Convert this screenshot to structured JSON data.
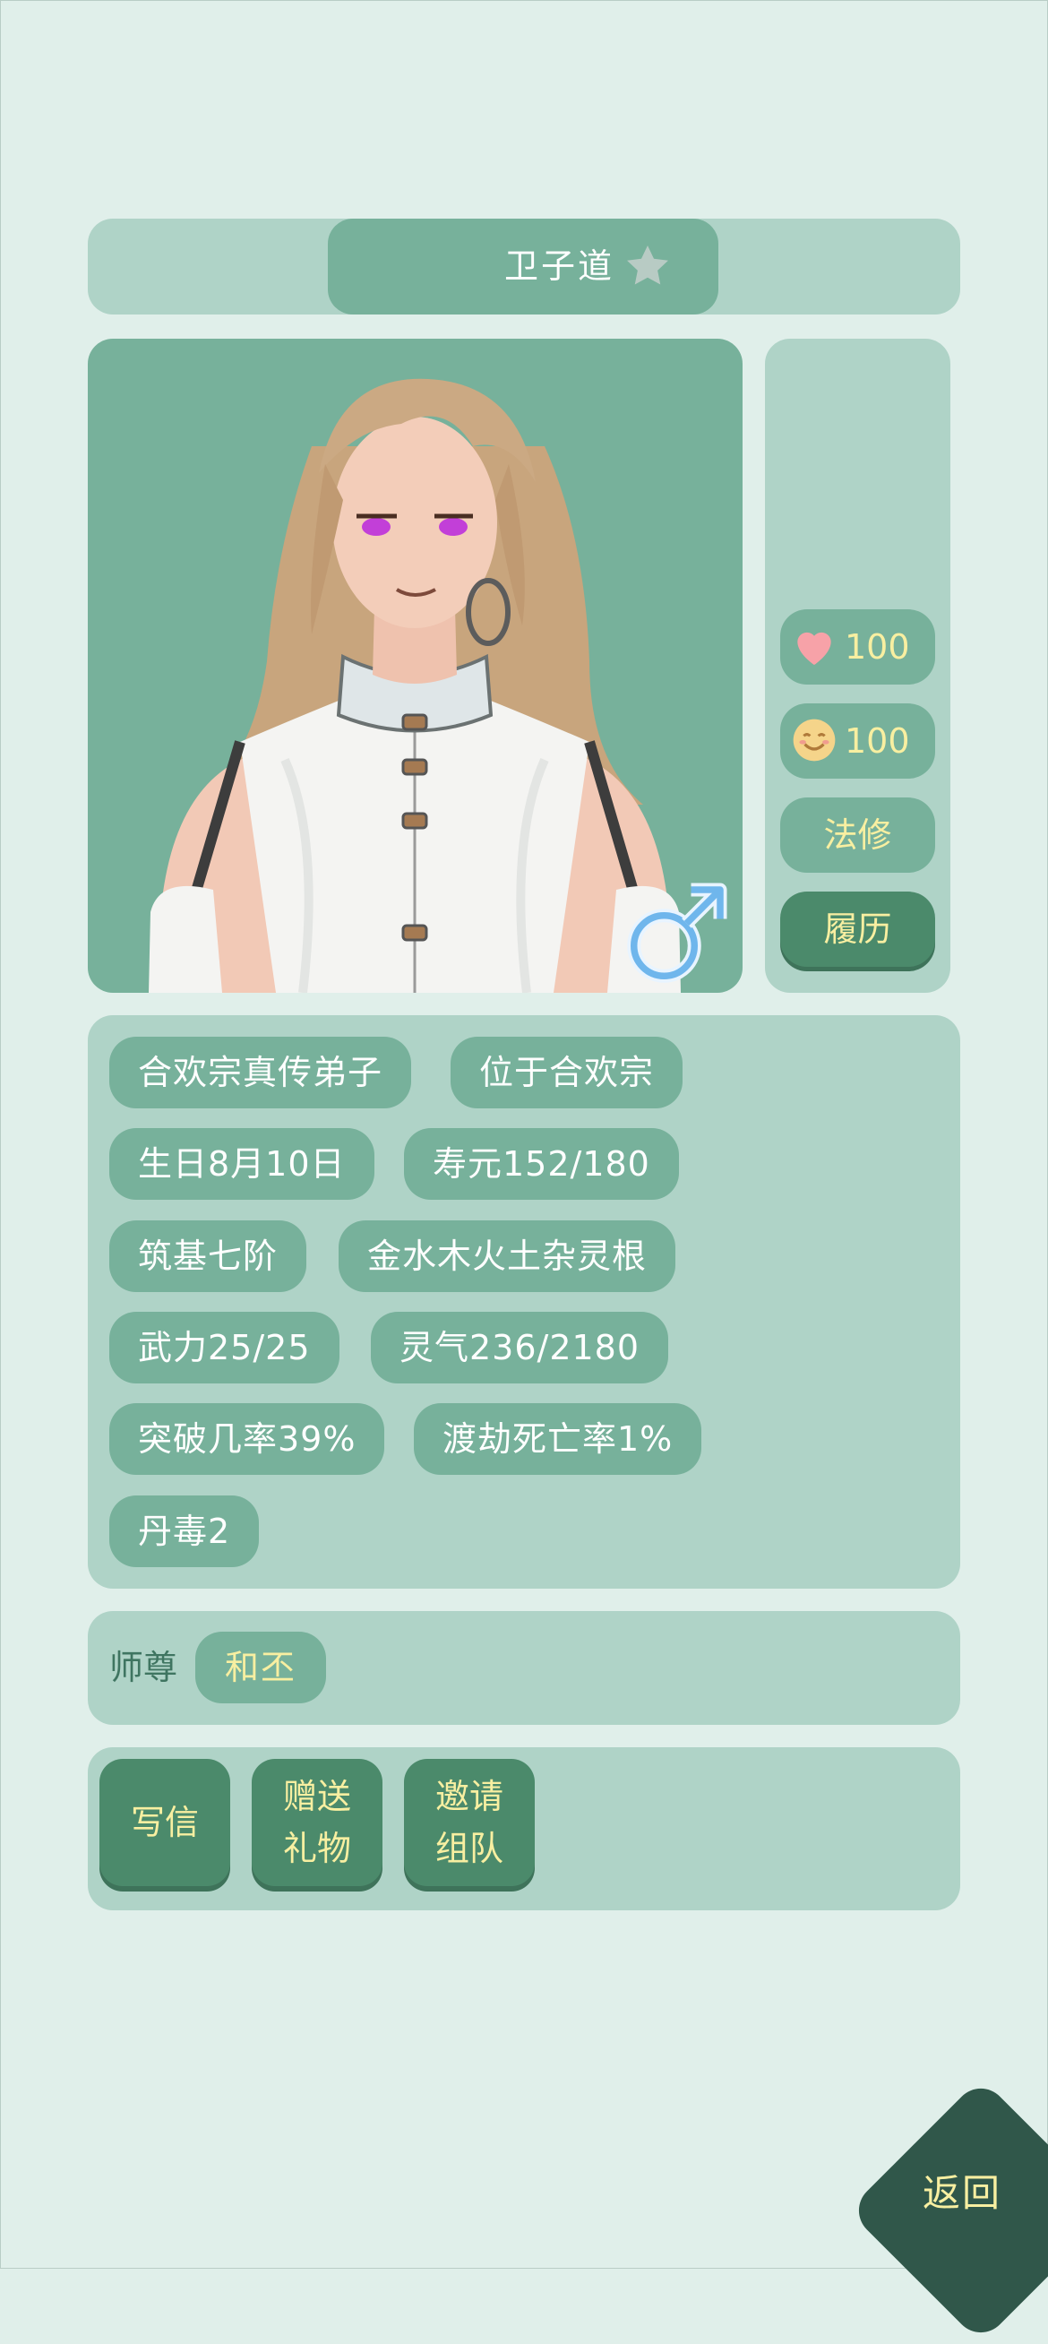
{
  "header": {
    "name": "卫子道",
    "favorite_icon": "star-icon"
  },
  "portrait": {
    "gender_icon": "male-symbol-icon"
  },
  "side_panel": {
    "affection": {
      "icon": "heart-icon",
      "value": "100"
    },
    "mood": {
      "icon": "smile-face-icon",
      "value": "100"
    },
    "cultivation_type": "法修",
    "history_button": "履历"
  },
  "info_tags": {
    "sect_rank": "合欢宗真传弟子",
    "location": "位于合欢宗",
    "birthday": "生日8月10日",
    "lifespan": "寿元152/180",
    "realm": "筑基七阶",
    "spirit_root": "金水木火土杂灵根",
    "martial": "武力25/25",
    "qi": "灵气236/2180",
    "breakthrough": "突破几率39%",
    "tribulation": "渡劫死亡率1%",
    "pill_toxicity": "丹毒2"
  },
  "master": {
    "label": "师尊",
    "name": "和丕"
  },
  "actions": {
    "write_letter": "写信",
    "gift_line1": "赠送",
    "gift_line2": "礼物",
    "invite_line1": "邀请",
    "invite_line2": "组队"
  },
  "back_button": "返回",
  "colors": {
    "background": "#e0efea",
    "panel": "#afd3c7",
    "chip": "#77b19b",
    "button_dark": "#4b8a6b",
    "accent_text": "#f8efa1",
    "back_button": "#30574a"
  }
}
